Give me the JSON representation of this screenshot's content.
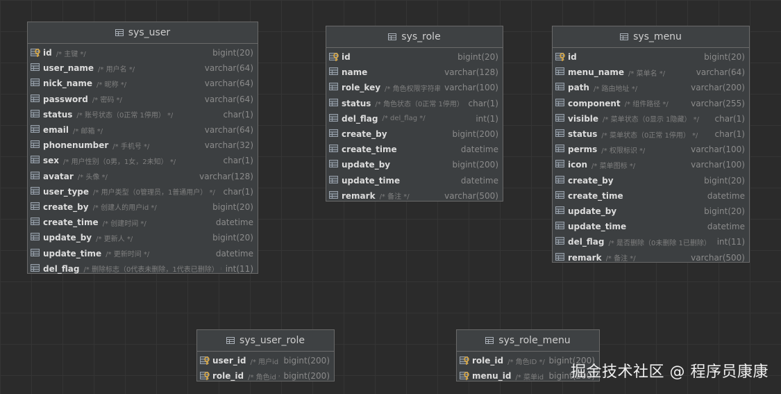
{
  "tables": [
    {
      "id": "sys_user",
      "title": "sys_user",
      "columns": [
        {
          "name": "id",
          "comment": "/* 主键 */",
          "type": "bigint(20)",
          "key": "pk"
        },
        {
          "name": "user_name",
          "comment": "/* 用户名 */",
          "type": "varchar(64)",
          "key": "col"
        },
        {
          "name": "nick_name",
          "comment": "/* 昵称 */",
          "type": "varchar(64)",
          "key": "col"
        },
        {
          "name": "password",
          "comment": "/* 密码 */",
          "type": "varchar(64)",
          "key": "col"
        },
        {
          "name": "status",
          "comment": "/* 账号状态（0正常 1停用） */",
          "type": "char(1)",
          "key": "col"
        },
        {
          "name": "email",
          "comment": "/* 邮箱 */",
          "type": "varchar(64)",
          "key": "col"
        },
        {
          "name": "phonenumber",
          "comment": "/* 手机号 */",
          "type": "varchar(32)",
          "key": "col"
        },
        {
          "name": "sex",
          "comment": "/* 用户性别（0男，1女，2未知） */",
          "type": "char(1)",
          "key": "col"
        },
        {
          "name": "avatar",
          "comment": "/* 头像 */",
          "type": "varchar(128)",
          "key": "col"
        },
        {
          "name": "user_type",
          "comment": "/* 用户类型（0管理员，1普通用户） */",
          "type": "char(1)",
          "key": "col"
        },
        {
          "name": "create_by",
          "comment": "/* 创建人的用户id */",
          "type": "bigint(20)",
          "key": "col"
        },
        {
          "name": "create_time",
          "comment": "/* 创建时间 */",
          "type": "datetime",
          "key": "col"
        },
        {
          "name": "update_by",
          "comment": "/* 更新人 */",
          "type": "bigint(20)",
          "key": "col"
        },
        {
          "name": "update_time",
          "comment": "/* 更新时间 */",
          "type": "datetime",
          "key": "col"
        },
        {
          "name": "del_flag",
          "comment": "/* 删除标志（0代表未删除，1代表已删除） */",
          "type": "int(11)",
          "key": "col"
        }
      ]
    },
    {
      "id": "sys_role",
      "title": "sys_role",
      "columns": [
        {
          "name": "id",
          "comment": "",
          "type": "bigint(20)",
          "key": "pk"
        },
        {
          "name": "name",
          "comment": "",
          "type": "varchar(128)",
          "key": "col"
        },
        {
          "name": "role_key",
          "comment": "/* 角色权限字符串 */",
          "type": "varchar(100)",
          "key": "col"
        },
        {
          "name": "status",
          "comment": "/* 角色状态（0正常 1停用） */",
          "type": "char(1)",
          "key": "col"
        },
        {
          "name": "del_flag",
          "comment": "/* del_flag */",
          "type": "int(1)",
          "key": "col"
        },
        {
          "name": "create_by",
          "comment": "",
          "type": "bigint(200)",
          "key": "col"
        },
        {
          "name": "create_time",
          "comment": "",
          "type": "datetime",
          "key": "col"
        },
        {
          "name": "update_by",
          "comment": "",
          "type": "bigint(200)",
          "key": "col"
        },
        {
          "name": "update_time",
          "comment": "",
          "type": "datetime",
          "key": "col"
        },
        {
          "name": "remark",
          "comment": "/* 备注 */",
          "type": "varchar(500)",
          "key": "col"
        }
      ]
    },
    {
      "id": "sys_menu",
      "title": "sys_menu",
      "columns": [
        {
          "name": "id",
          "comment": "",
          "type": "bigint(20)",
          "key": "pk"
        },
        {
          "name": "menu_name",
          "comment": "/* 菜单名 */",
          "type": "varchar(64)",
          "key": "col"
        },
        {
          "name": "path",
          "comment": "/* 路由地址 */",
          "type": "varchar(200)",
          "key": "col"
        },
        {
          "name": "component",
          "comment": "/* 组件路径 */",
          "type": "varchar(255)",
          "key": "col"
        },
        {
          "name": "visible",
          "comment": "/* 菜单状态（0显示 1隐藏） */",
          "type": "char(1)",
          "key": "col"
        },
        {
          "name": "status",
          "comment": "/* 菜单状态（0正常 1停用） */",
          "type": "char(1)",
          "key": "col"
        },
        {
          "name": "perms",
          "comment": "/* 权限标识 */",
          "type": "varchar(100)",
          "key": "col"
        },
        {
          "name": "icon",
          "comment": "/* 菜单图标 */",
          "type": "varchar(100)",
          "key": "col"
        },
        {
          "name": "create_by",
          "comment": "",
          "type": "bigint(20)",
          "key": "col"
        },
        {
          "name": "create_time",
          "comment": "",
          "type": "datetime",
          "key": "col"
        },
        {
          "name": "update_by",
          "comment": "",
          "type": "bigint(20)",
          "key": "col"
        },
        {
          "name": "update_time",
          "comment": "",
          "type": "datetime",
          "key": "col"
        },
        {
          "name": "del_flag",
          "comment": "/* 是否删除（0未删除 1已删除） */",
          "type": "int(11)",
          "key": "col"
        },
        {
          "name": "remark",
          "comment": "/* 备注 */",
          "type": "varchar(500)",
          "key": "col"
        }
      ]
    },
    {
      "id": "sys_user_role",
      "title": "sys_user_role",
      "columns": [
        {
          "name": "user_id",
          "comment": "/* 用户id */",
          "type": "bigint(200)",
          "key": "pk"
        },
        {
          "name": "role_id",
          "comment": "/* 角色id */",
          "type": "bigint(200)",
          "key": "pk"
        }
      ]
    },
    {
      "id": "sys_role_menu",
      "title": "sys_role_menu",
      "columns": [
        {
          "name": "role_id",
          "comment": "/* 角色ID */",
          "type": "bigint(200)",
          "key": "pk"
        },
        {
          "name": "menu_id",
          "comment": "/* 菜单id */",
          "type": "bigint(200)",
          "key": "pk"
        }
      ]
    }
  ],
  "watermark": "掘金技术社区 @ 程序员康康",
  "colors": {
    "background": "#2b2b2b",
    "table_body": "#3c3f41",
    "table_border": "#6a6a6a",
    "column_name": "#dcdcdc",
    "comment": "#7f7f7f",
    "type": "#8b8b8b",
    "key_icon": "#d9a53c"
  },
  "icons": {
    "header": "table-icon",
    "primary_key": "primary-key-icon",
    "column": "column-icon"
  }
}
